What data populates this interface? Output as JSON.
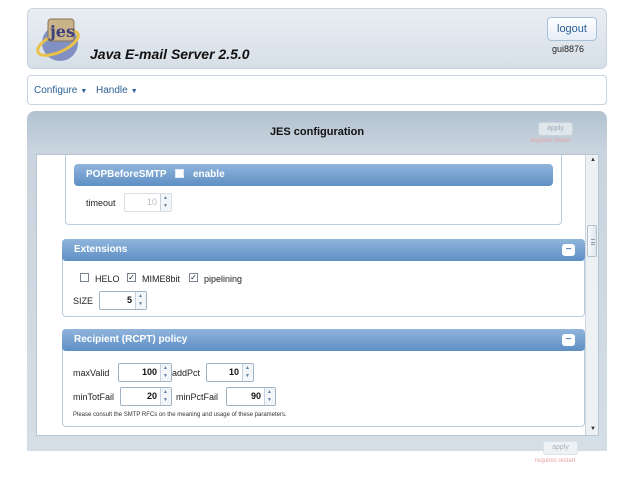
{
  "header": {
    "title": "Java E-mail Server 2.5.0",
    "logout": "logout",
    "username": "gui8876"
  },
  "menu": {
    "items": [
      {
        "label": "Configure"
      },
      {
        "label": "Handle"
      }
    ]
  },
  "config": {
    "title": "JES configuration",
    "apply": "apply",
    "requires_restart": "requires restart",
    "pop_before_smtp": {
      "title": "POPBeforeSMTP",
      "enable_label": "enable",
      "timeout_label": "timeout",
      "timeout_value": "10"
    },
    "extensions": {
      "title": "Extensions",
      "helo": "HELO",
      "mime8bit": "MIME8bit",
      "pipelining": "pipelining",
      "size_label": "SIZE",
      "size_value": "5"
    },
    "rcpt_policy": {
      "title": "Recipient (RCPT) policy",
      "max_valid_label": "maxValid",
      "max_valid": "100",
      "add_pct_label": "addPct",
      "add_pct": "10",
      "min_tot_fail_label": "minTotFail",
      "min_tot_fail": "20",
      "min_pct_fail_label": "minPctFail",
      "min_pct_fail": "90",
      "note": "Please consult the SMTP RFCs on the meaning and usage of these parameters."
    }
  },
  "footer": {
    "apply": "apply",
    "requires_restart": "requires restart"
  }
}
